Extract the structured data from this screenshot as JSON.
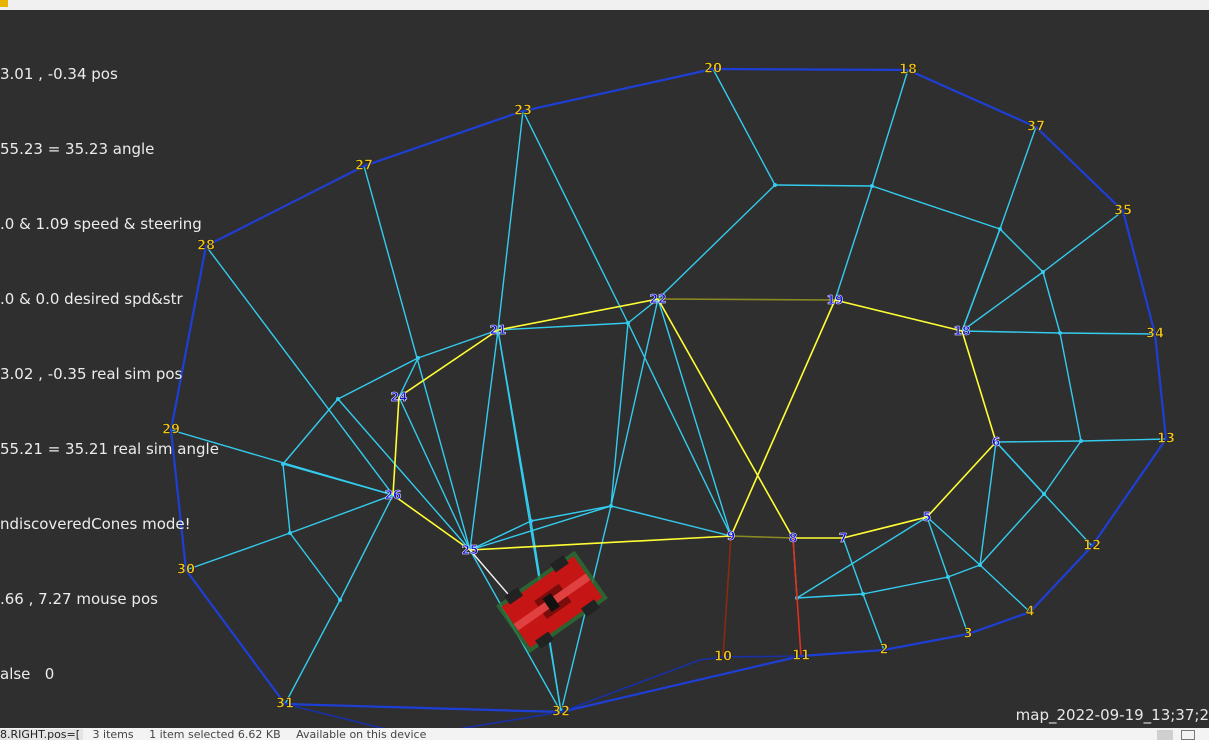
{
  "window": {
    "title_visible": ""
  },
  "debug_lines": [
    "3.01 , -0.34 pos",
    "55.23 = 35.23 angle",
    ".0 & 1.09 speed & steering",
    ".0 & 0.0 desired spd&str",
    "3.02 , -0.35 real sim pos",
    "55.21 = 35.21 real sim angle",
    "ndiscoveredCones mode!",
    ".66 , 7.27 mouse pos",
    "alse   0"
  ],
  "map_name": "map_2022-09-19_13;37;2",
  "status_bar": {
    "code_text": "8.RIGHT.pos=[",
    "items": "3 items",
    "selected": "1 item selected  6.62 KB",
    "availability": "Available on this device"
  },
  "colors": {
    "background": "#2f2f2f",
    "outer_boundary": "#1e3fd6",
    "inner_boundary": "#ffff33",
    "mesh": "#33ccee",
    "mesh_dim": "#8a8a22",
    "path_red": "#e03020",
    "path_brown": "#8a2a10",
    "outer_label": "#f0c419",
    "inner_label": "#1410d8",
    "car_body": "#d01818"
  },
  "cones": {
    "outer": [
      {
        "id": "20",
        "label": "20"
      },
      {
        "id": "18",
        "label": "18"
      },
      {
        "id": "37",
        "label": "37"
      },
      {
        "id": "35",
        "label": "35"
      },
      {
        "id": "34",
        "label": "34"
      },
      {
        "id": "13",
        "label": "13"
      },
      {
        "id": "12",
        "label": "12"
      },
      {
        "id": "4",
        "label": "4"
      },
      {
        "id": "3",
        "label": "3"
      },
      {
        "id": "2",
        "label": "2"
      },
      {
        "id": "11",
        "label": "11"
      },
      {
        "id": "10",
        "label": "10"
      },
      {
        "id": "32",
        "label": "32"
      },
      {
        "id": "31",
        "label": "31"
      },
      {
        "id": "30",
        "label": "30"
      },
      {
        "id": "29",
        "label": "29"
      },
      {
        "id": "28",
        "label": "28"
      },
      {
        "id": "27",
        "label": "27"
      },
      {
        "id": "23",
        "label": "23"
      }
    ],
    "inner": [
      {
        "id": "i22",
        "label": "22"
      },
      {
        "id": "i19",
        "label": "19"
      },
      {
        "id": "i18",
        "label": "18"
      },
      {
        "id": "i6",
        "label": "6"
      },
      {
        "id": "i5",
        "label": "5"
      },
      {
        "id": "i7",
        "label": "7"
      },
      {
        "id": "i8",
        "label": "8"
      },
      {
        "id": "i9",
        "label": "9"
      },
      {
        "id": "i25",
        "label": "25"
      },
      {
        "id": "i26",
        "label": "26"
      },
      {
        "id": "i24",
        "label": "24"
      },
      {
        "id": "i21",
        "label": "21"
      }
    ]
  },
  "car": {
    "icon": "race-car-icon"
  }
}
